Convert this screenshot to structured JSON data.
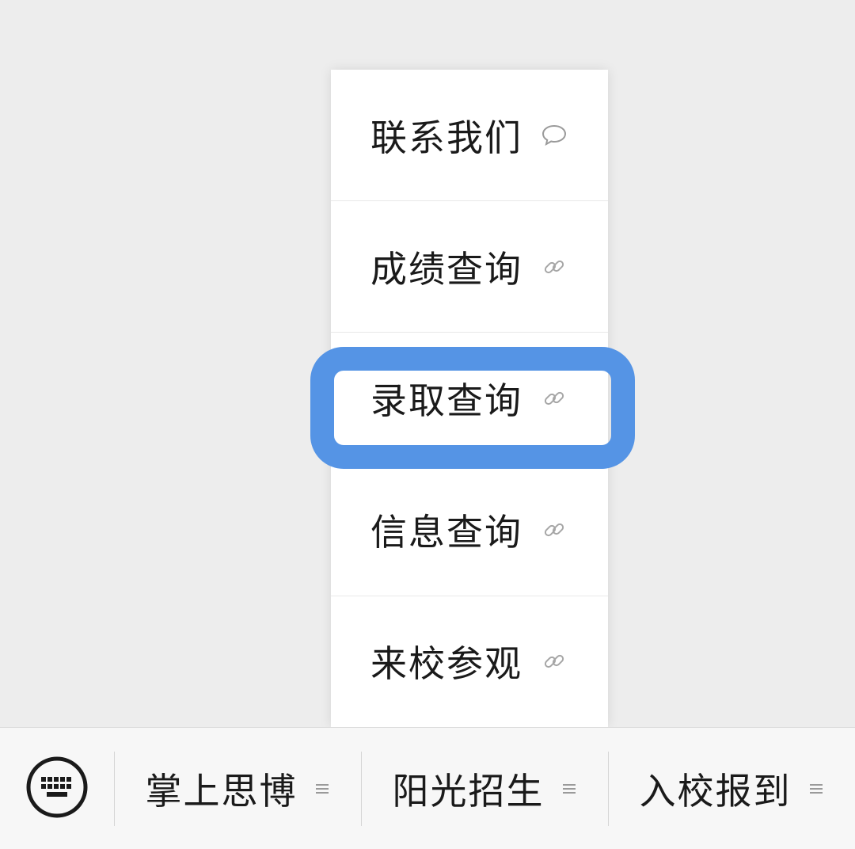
{
  "menu": {
    "items": [
      {
        "label": "联系我们",
        "icon": "chat-bubble-icon"
      },
      {
        "label": "成绩查询",
        "icon": "link-icon"
      },
      {
        "label": "录取查询",
        "icon": "link-icon",
        "highlighted": true
      },
      {
        "label": "信息查询",
        "icon": "link-icon"
      },
      {
        "label": "来校参观",
        "icon": "link-icon"
      }
    ]
  },
  "bottom_bar": {
    "keyboard_icon": "keyboard-icon",
    "tabs": [
      {
        "label": "掌上思博",
        "icon": "menu-lines-icon"
      },
      {
        "label": "阳光招生",
        "icon": "menu-lines-icon"
      },
      {
        "label": "入校报到",
        "icon": "menu-lines-icon"
      }
    ]
  },
  "colors": {
    "highlight": "#5594e5",
    "background": "#ededed",
    "menu_background": "#ffffff"
  }
}
